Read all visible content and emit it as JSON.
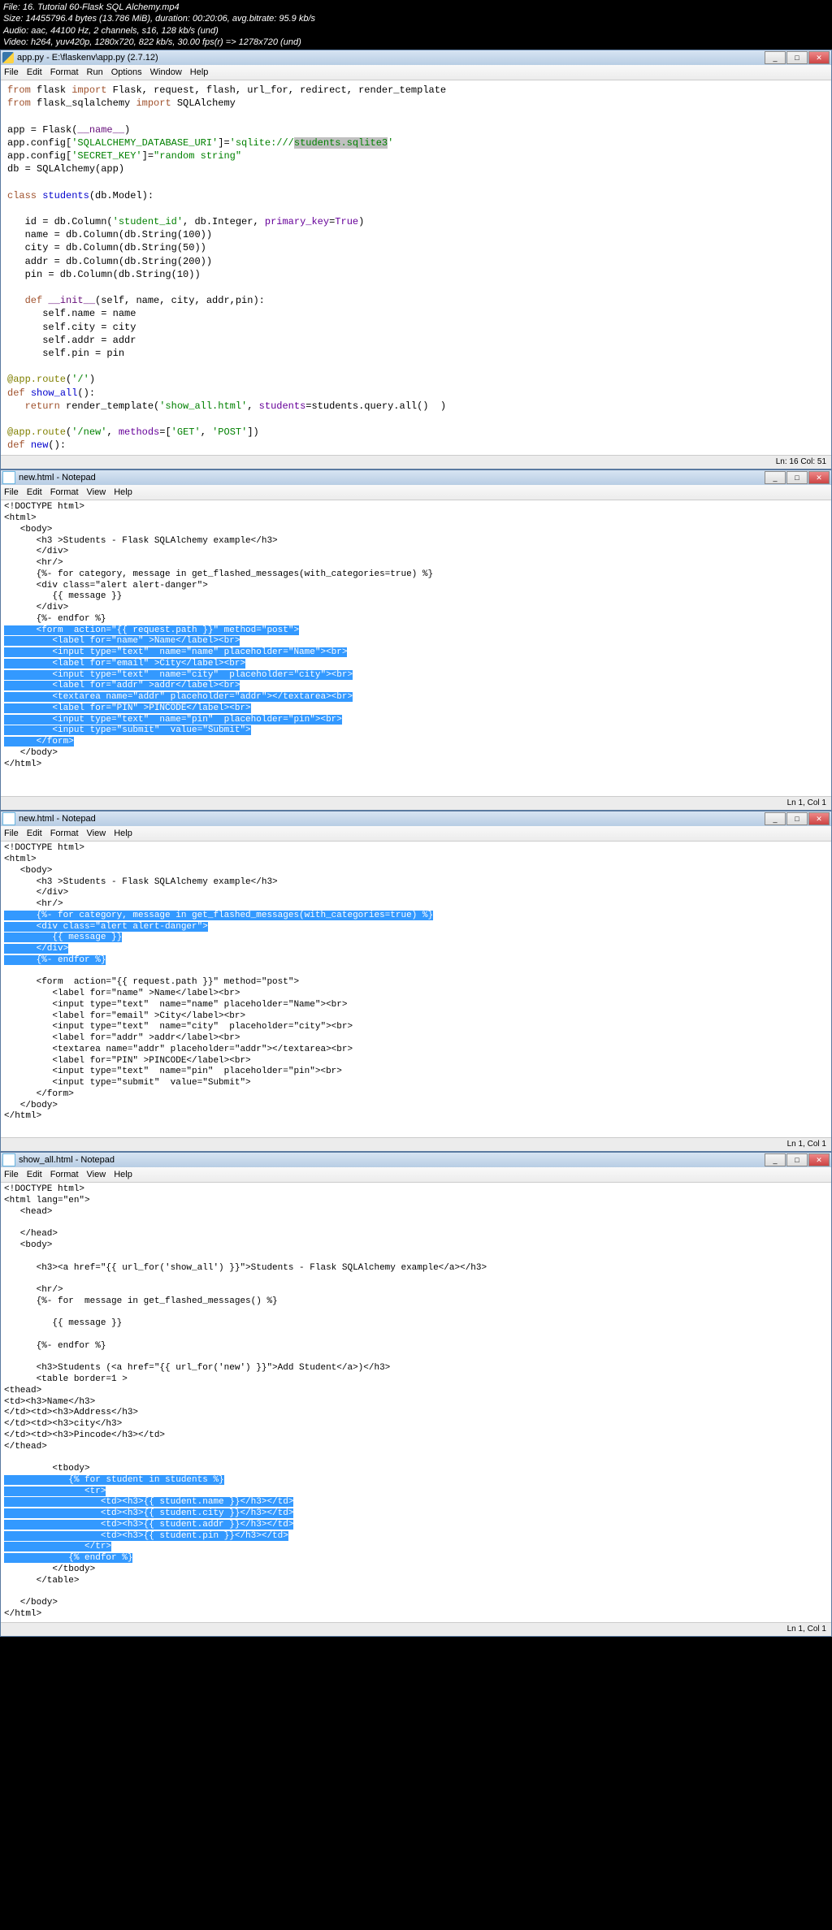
{
  "video_info": {
    "file": "File: 16. Tutorial 60-Flask SQL Alchemy.mp4",
    "size": "Size: 14455796.4 bytes (13.786 MiB), duration: 00:20:06, avg.bitrate: 95.9 kb/s",
    "audio": "Audio: aac, 44100 Hz, 2 channels, s16, 128 kb/s (und)",
    "video": "Video: h264, yuv420p, 1280x720, 822 kb/s, 30.00 fps(r) => 1278x720 (und)"
  },
  "editor": {
    "title": "app.py - E:\\flaskenv\\app.py (2.7.12)",
    "menu": [
      "File",
      "Edit",
      "Format",
      "Run",
      "Options",
      "Window",
      "Help"
    ],
    "status": "Ln: 16 Col: 51"
  },
  "notepad1": {
    "title": "new.html - Notepad",
    "menu": [
      "File",
      "Edit",
      "Format",
      "View",
      "Help"
    ],
    "status": "Ln 1, Col 1"
  },
  "notepad2": {
    "title": "new.html - Notepad",
    "menu": [
      "File",
      "Edit",
      "Format",
      "View",
      "Help"
    ],
    "status": "Ln 1, Col 1"
  },
  "notepad3": {
    "title": "show_all.html - Notepad",
    "menu": [
      "File",
      "Edit",
      "Format",
      "View",
      "Help"
    ],
    "status": "Ln 1, Col 1"
  },
  "python_code": {
    "l1a": "from",
    "l1b": " flask ",
    "l1c": "import",
    "l1d": " Flask, request, flash, url_for, redirect, render_template",
    "l2a": "from",
    "l2b": " flask_sqlalchemy ",
    "l2c": "import",
    "l2d": " SQLAlchemy",
    "l3": "",
    "l4a": "app = Flask(",
    "l4b": "__name__",
    "l4c": ")",
    "l5a": "app.config[",
    "l5b": "'SQLALCHEMY_DATABASE_URI'",
    "l5c": "]=",
    "l5d": "'sqlite:///",
    "l5e": "students.sqlite3",
    "l5f": "'",
    "l6a": "app.config[",
    "l6b": "'SECRET_KEY'",
    "l6c": "]=",
    "l6d": "\"random string\"",
    "l7": "db = SQLAlchemy(app)",
    "l8": "",
    "l9a": "class ",
    "l9b": "students",
    "l9c": "(db.Model):",
    "l10": "",
    "l11a": "   id = db.Column(",
    "l11b": "'student_id'",
    "l11c": ", db.Integer, ",
    "l11d": "primary_key",
    "l11e": "=",
    "l11f": "True",
    "l11g": ")",
    "l12": "   name = db.Column(db.String(100))",
    "l13": "   city = db.Column(db.String(50))",
    "l14": "   addr = db.Column(db.String(200))",
    "l15": "   pin = db.Column(db.String(10))",
    "l16": "",
    "l17a": "   def ",
    "l17b": "__init__",
    "l17c": "(self, name, city, addr,pin):",
    "l18": "      self.name = name",
    "l19": "      self.city = city",
    "l20": "      self.addr = addr",
    "l21": "      self.pin = pin",
    "l22": "",
    "l23a": "@app.route",
    "l23b": "(",
    "l23c": "'/'",
    "l23d": ")",
    "l24a": "def ",
    "l24b": "show_all",
    "l24c": "():",
    "l25a": "   return ",
    "l25b": "render_template(",
    "l25c": "'show_all.html'",
    "l25d": ", ",
    "l25e": "students",
    "l25f": "=students.query.all()  )",
    "l26": "",
    "l27a": "@app.route",
    "l27b": "(",
    "l27c": "'/new'",
    "l27d": ", ",
    "l27e": "methods",
    "l27f": "=[",
    "l27g": "'GET'",
    "l27h": ", ",
    "l27i": "'POST'",
    "l27j": "])",
    "l28a": "def ",
    "l28b": "new",
    "l28c": "():"
  },
  "html1": {
    "pre": "<!DOCTYPE html>\n<html>\n   <body>\n      <h3 >Students - Flask SQLAlchemy example</h3>\n      </div>\n      <hr/>\n      {%- for category, message in get_flashed_messages(with_categories=true) %}\n      <div class=\"alert alert-danger\">\n         {{ message }}\n      </div>\n      {%- endfor %}\n",
    "sel": "      <form  action=\"{{ request.path }}\" method=\"post\">\n         <label for=\"name\" >Name</label><br>\n         <input type=\"text\"  name=\"name\" placeholder=\"Name\"><br>\n         <label for=\"email\" >City</label><br>\n         <input type=\"text\"  name=\"city\"  placeholder=\"city\"><br>\n         <label for=\"addr\" >addr</label><br>\n         <textarea name=\"addr\" placeholder=\"addr\"></textarea><br>\n         <label for=\"PIN\" >PINCODE</label><br>\n         <input type=\"text\"  name=\"pin\"  placeholder=\"pin\"><br>\n         <input type=\"submit\"  value=\"Submit\">\n      </form>",
    "post": "\n   </body>\n</html>"
  },
  "html2": {
    "pre": "<!DOCTYPE html>\n<html>\n   <body>\n      <h3 >Students - Flask SQLAlchemy example</h3>\n      </div>\n      <hr/>\n",
    "sel": "      {%- for category, message in get_flashed_messages(with_categories=true) %}\n      <div class=\"alert alert-danger\">\n         {{ message }}\n      </div>\n      {%- endfor %}",
    "post": "\n\n      <form  action=\"{{ request.path }}\" method=\"post\">\n         <label for=\"name\" >Name</label><br>\n         <input type=\"text\"  name=\"name\" placeholder=\"Name\"><br>\n         <label for=\"email\" >City</label><br>\n         <input type=\"text\"  name=\"city\"  placeholder=\"city\"><br>\n         <label for=\"addr\" >addr</label><br>\n         <textarea name=\"addr\" placeholder=\"addr\"></textarea><br>\n         <label for=\"PIN\" >PINCODE</label><br>\n         <input type=\"text\"  name=\"pin\"  placeholder=\"pin\"><br>\n         <input type=\"submit\"  value=\"Submit\">\n      </form>\n   </body>\n</html>"
  },
  "html3": {
    "pre": "<!DOCTYPE html>\n<html lang=\"en\">\n   <head>\n\n   </head>\n   <body>\n\n      <h3><a href=\"{{ url_for('show_all') }}\">Students - Flask SQLAlchemy example</a></h3>\n\n      <hr/>\n      {%- for  message in get_flashed_messages() %}\n\n         {{ message }}\n\n      {%- endfor %}\n\n      <h3>Students (<a href=\"{{ url_for('new') }}\">Add Student</a>)</h3>\n      <table border=1 >\n<thead>\n<td><h3>Name</h3>\n</td><td><h3>Address</h3>\n</td><td><h3>city</h3>\n</td><td><h3>Pincode</h3></td>\n</thead>\n\n         <tbody>\n",
    "sel": "            {% for student in students %}\n               <tr>\n                  <td><h3>{{ student.name }}</h3></td>\n                  <td><h3>{{ student.city }}</h3></td>\n                  <td><h3>{{ student.addr }}</h3></td>\n                  <td><h3>{{ student.pin }}</h3></td>\n               </tr>\n            {% endfor %}",
    "post": "\n         </tbody>\n      </table>\n\n   </body>\n</html>"
  }
}
